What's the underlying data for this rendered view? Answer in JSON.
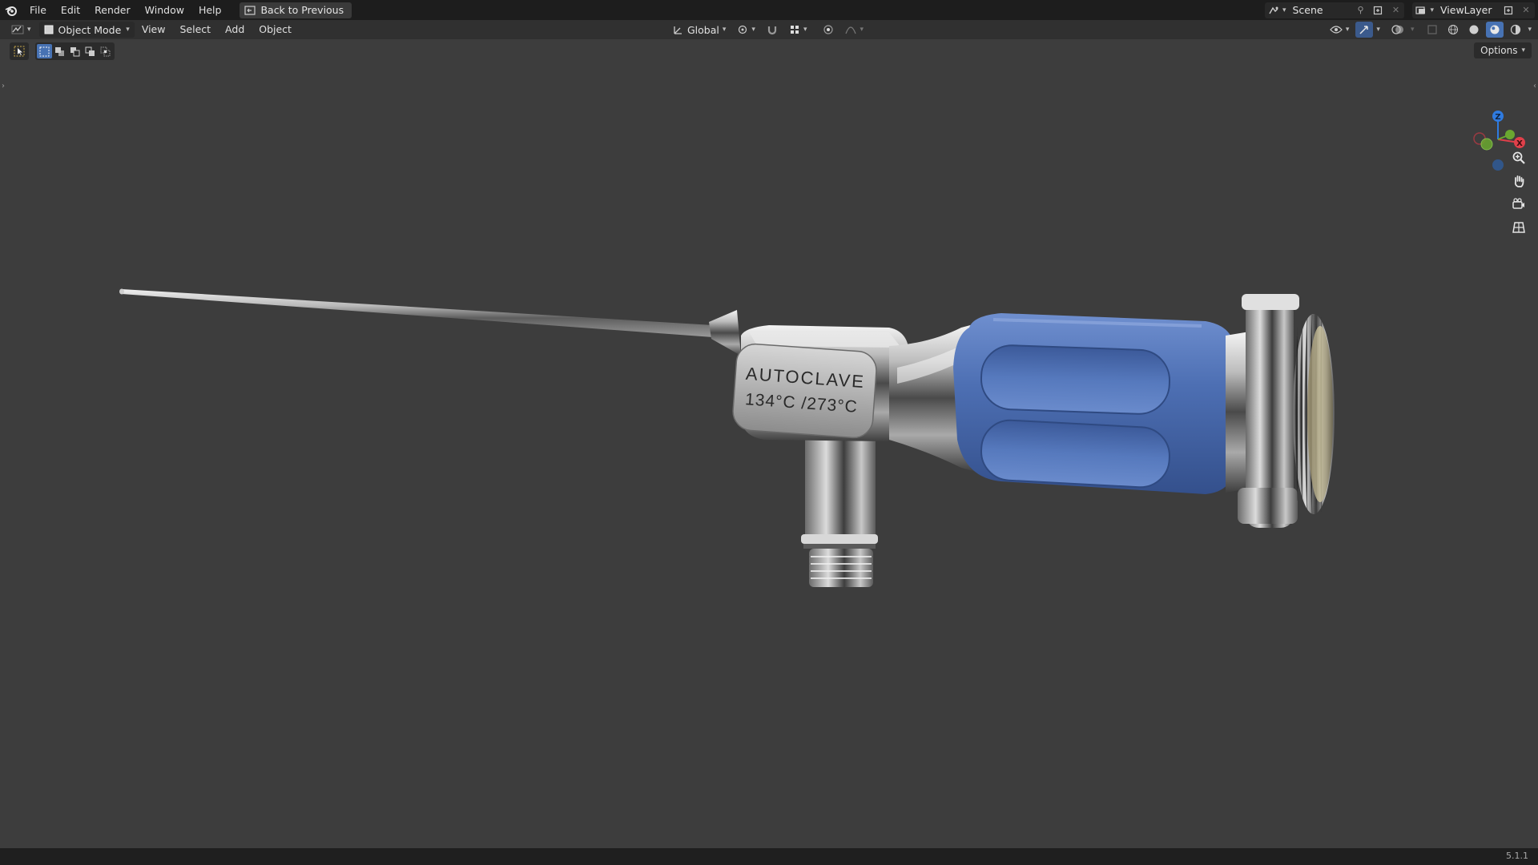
{
  "menubar": {
    "items": [
      "File",
      "Edit",
      "Render",
      "Window",
      "Help"
    ],
    "back_button": "Back to Previous",
    "scene": "Scene",
    "view_layer": "ViewLayer"
  },
  "header": {
    "mode": "Object Mode",
    "menus": [
      "View",
      "Select",
      "Add",
      "Object"
    ],
    "transform_orientation": "Global"
  },
  "viewport": {
    "options_label": "Options",
    "label_line1": "AUTOCLAVE",
    "label_line2": "134°C /273°C",
    "gizmo_axes": {
      "z": "Z",
      "x": "X"
    }
  },
  "status": {
    "version": "5.1.1"
  },
  "colors": {
    "accent": "#4772b3",
    "grip": "#4a6db0",
    "axis_x": "#e0404a",
    "axis_y": "#6aa830",
    "axis_z": "#2f7be0"
  },
  "icons": [
    "blender-logo-icon",
    "editor-type-icon",
    "select-cursor-icon",
    "zoom-icon",
    "pan-hand-icon",
    "camera-icon",
    "perspective-grid-icon"
  ]
}
